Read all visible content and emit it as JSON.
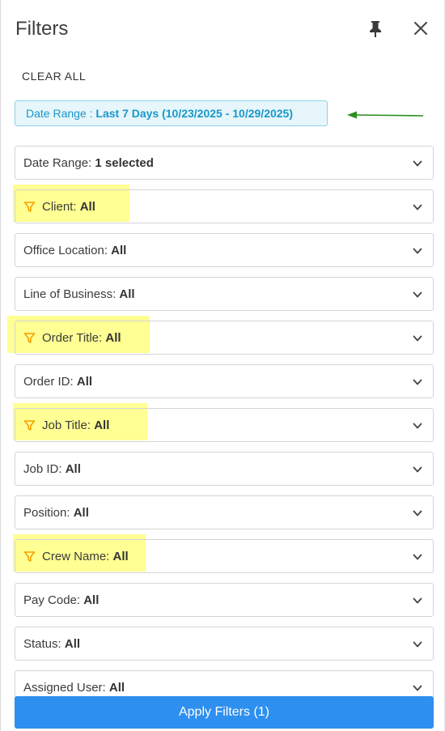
{
  "panel": {
    "title": "Filters",
    "clear_all": "CLEAR ALL"
  },
  "chip": {
    "label": "Date Range : ",
    "value": "Last 7 Days (10/23/2025 - 10/29/2025)"
  },
  "filters": [
    {
      "label": "Date Range: ",
      "value": "1 selected",
      "highlighted": false
    },
    {
      "label": "Client: ",
      "value": "All",
      "highlighted": true
    },
    {
      "label": "Office Location: ",
      "value": "All",
      "highlighted": false
    },
    {
      "label": "Line of Business: ",
      "value": "All",
      "highlighted": false
    },
    {
      "label": "Order Title: ",
      "value": "All",
      "highlighted": true
    },
    {
      "label": "Order ID: ",
      "value": "All",
      "highlighted": false
    },
    {
      "label": "Job Title: ",
      "value": "All",
      "highlighted": true
    },
    {
      "label": "Job ID: ",
      "value": "All",
      "highlighted": false
    },
    {
      "label": "Position: ",
      "value": "All",
      "highlighted": false
    },
    {
      "label": "Crew Name: ",
      "value": "All",
      "highlighted": true
    },
    {
      "label": "Pay Code: ",
      "value": "All",
      "highlighted": false
    },
    {
      "label": "Status: ",
      "value": "All",
      "highlighted": false
    },
    {
      "label": "Assigned User: ",
      "value": "All",
      "highlighted": false
    }
  ],
  "apply_label": "Apply Filters (1)",
  "colors": {
    "accent": "#2d8fef",
    "chip_text": "#1a97c9",
    "highlight": "#ffff80",
    "funnel": "#f5a000",
    "arrow": "#2a8f1f"
  },
  "icons": {
    "pin": "pin-icon",
    "close": "close-icon",
    "chevron": "chevron-down-icon",
    "funnel": "filter-funnel-icon"
  }
}
